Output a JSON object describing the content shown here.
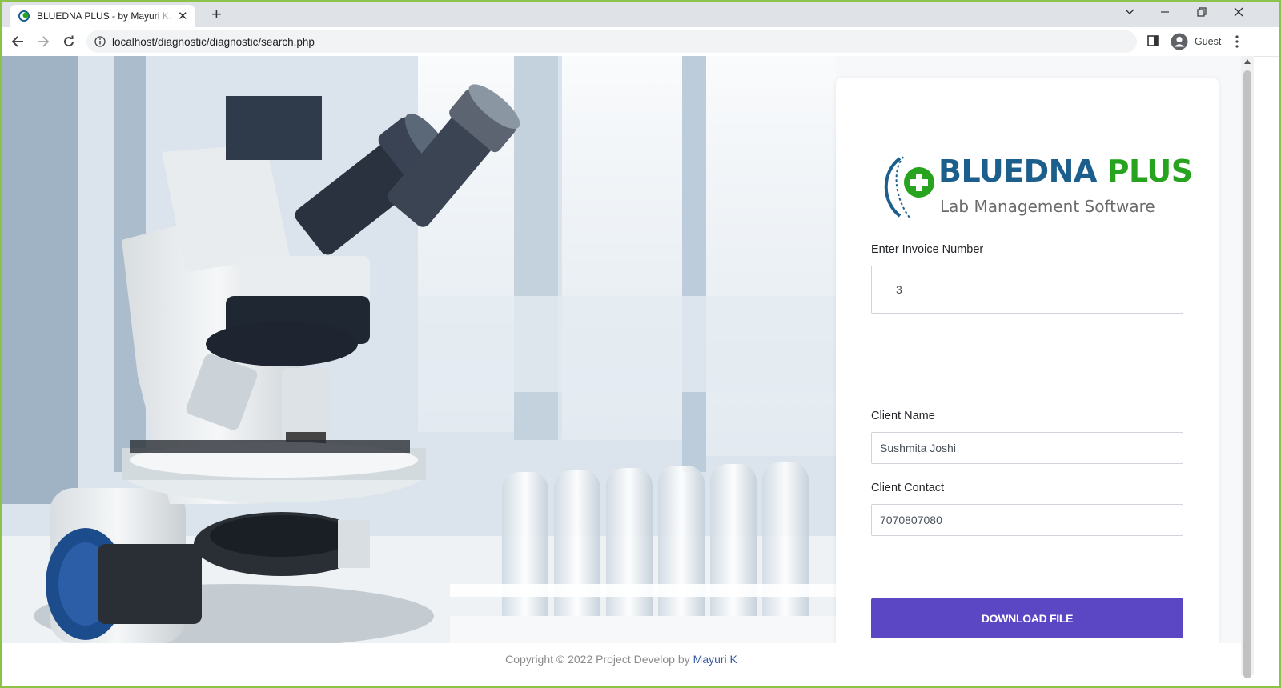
{
  "browser": {
    "tab_title": "BLUEDNA PLUS - by Mayuri K. Freelancer",
    "url": "localhost/diagnostic/diagnostic/search.php",
    "profile_label": "Guest",
    "accent_color": "#8bc34a"
  },
  "brand": {
    "name_part1": "BLUEDNA",
    "name_part2": "PLUS",
    "tagline": "Lab Management Software",
    "colors": {
      "blue": "#1c5f8c",
      "green": "#27a31f",
      "grey": "#6b6b6b"
    }
  },
  "form": {
    "invoice_label": "Enter Invoice Number",
    "invoice_value": "3",
    "client_name_label": "Client Name",
    "client_name_value": "Sushmita Joshi",
    "client_contact_label": "Client Contact",
    "client_contact_value": "7070807080",
    "download_button": "DOWNLOAD FILE",
    "button_color": "#5b46c4"
  },
  "footer": {
    "text": "Copyright © 2022 Project Develop by",
    "author": "Mayuri K"
  },
  "icons": {
    "back": "back-arrow-icon",
    "forward": "forward-arrow-icon",
    "reload": "reload-icon",
    "info": "info-icon",
    "side_panel": "side-panel-icon",
    "profile": "profile-icon",
    "menu": "kebab-menu-icon"
  }
}
